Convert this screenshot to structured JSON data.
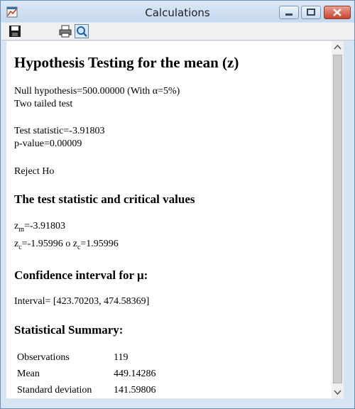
{
  "window": {
    "title": "Calculations"
  },
  "toolbar": {
    "save": "save-icon",
    "print": "printer-icon",
    "preview": "print-preview-icon"
  },
  "report": {
    "heading": "Hypothesis Testing for the mean (z)",
    "null_hypothesis": "Null hypothesis=500.00000 (With α=5%)",
    "test_type": "Two tailed test",
    "test_statistic": "Test statistic=-3.91803",
    "p_value": "p-value=0.00009",
    "decision": "Reject Ho",
    "critical_heading": "The test statistic and critical values",
    "zm": {
      "sym": "z",
      "sub": "m",
      "rest": "=-3.91803"
    },
    "zc": {
      "sym1": "z",
      "sub1": "c",
      "mid": "=-1.95996 o ",
      "sym2": "z",
      "sub2": "c",
      "rest": "=1.95996"
    },
    "ci_heading": "Confidence interval for μ:",
    "interval": "Interval= [423.70203, 474.58369]",
    "summary_heading": "Statistical Summary:",
    "summary": [
      {
        "label": "Observations",
        "value": "119"
      },
      {
        "label": "Mean",
        "value": "449.14286"
      },
      {
        "label": "Standard deviation",
        "value": "141.59806"
      }
    ]
  },
  "colors": {
    "frame": "#d7e4f2",
    "close_button": "#c7442d"
  }
}
